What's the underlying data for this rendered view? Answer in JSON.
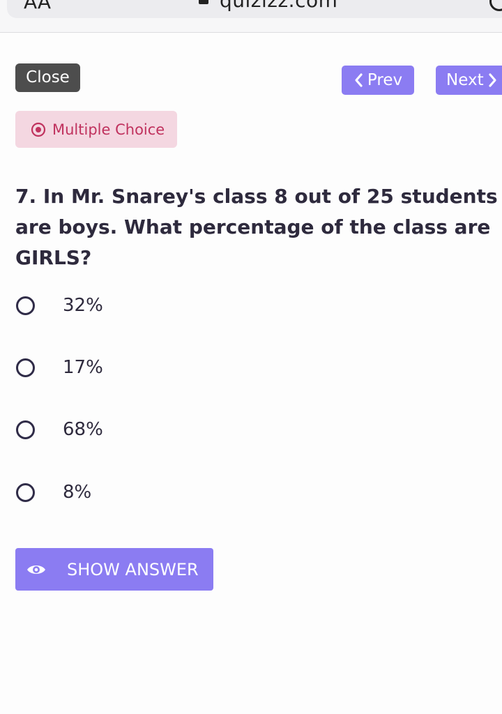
{
  "browser": {
    "text_size_label": "AA",
    "url": "quizizz.com"
  },
  "nav": {
    "close_label": "Close",
    "prev_label": "Prev",
    "next_label": "Next"
  },
  "question": {
    "type_label": "Multiple Choice",
    "text": "7. In Mr. Snarey's class 8 out of 25 students are boys. What percentage of the class are GIRLS?",
    "options": [
      {
        "label": "32%"
      },
      {
        "label": "17%"
      },
      {
        "label": "68%"
      },
      {
        "label": "8%"
      }
    ]
  },
  "show_answer_label": "SHOW ANSWER",
  "colors": {
    "accent": "#8b7cf2",
    "close_button": "#4d4d4d",
    "badge_bg": "#f4d7e1",
    "badge_text": "#c0325e"
  },
  "icons": {
    "prev": "chevron-left-icon",
    "next": "chevron-right-icon",
    "badge": "radio-dot-icon",
    "show_answer": "eye-icon"
  }
}
